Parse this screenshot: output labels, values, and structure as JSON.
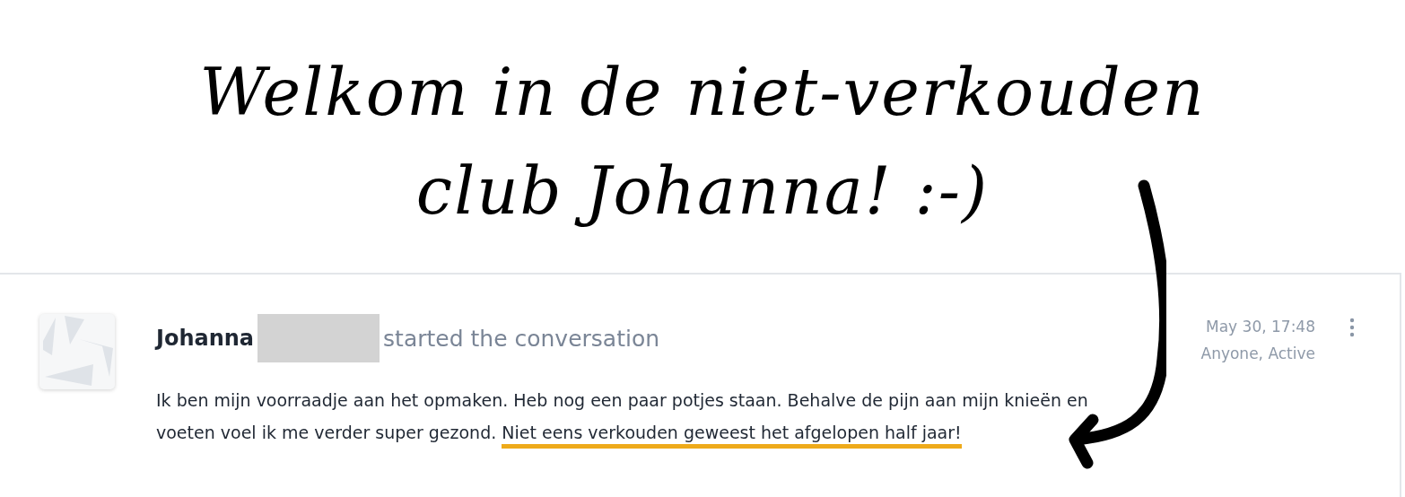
{
  "annotation": {
    "title_lines": [
      "Welkom in de niet-verkouden",
      "club Johanna! :-)"
    ]
  },
  "post": {
    "author": "Johanna",
    "action": "started the conversation",
    "time": "May 30, 17:48",
    "audience": "Anyone, Active",
    "body": "Ik ben mijn voorraadje aan het opmaken. Heb nog een paar potjes staan. Behalve de pijn aan mijn knieën en voeten voel ik me verder super gezond.",
    "highlight": "Niet eens verkouden geweest het afgelopen half jaar!"
  }
}
